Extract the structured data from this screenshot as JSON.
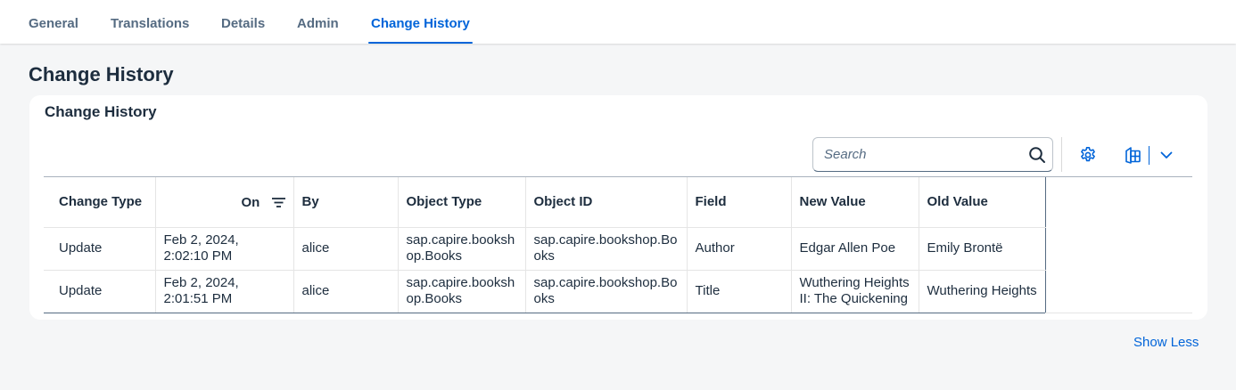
{
  "tabs": [
    {
      "label": "General"
    },
    {
      "label": "Translations"
    },
    {
      "label": "Details"
    },
    {
      "label": "Admin"
    },
    {
      "label": "Change History",
      "active": true
    }
  ],
  "section_title": "Change History",
  "card": {
    "title": "Change History",
    "search": {
      "placeholder": "Search",
      "value": ""
    },
    "toolbar": {
      "settings_icon": "gear-icon",
      "export_icon": "export-spreadsheet-icon",
      "export_menu_icon": "chevron-down-icon"
    },
    "table": {
      "columns": [
        "Change Type",
        "On",
        "By",
        "Object Type",
        "Object ID",
        "Field",
        "New Value",
        "Old Value"
      ],
      "rows": [
        {
          "change_type": "Update",
          "on_line1": "Feb 2, 2024,",
          "on_line2": "2:02:10 PM",
          "by": "alice",
          "object_type_line1": "sap.capire.booksh",
          "object_type_line2": "op.Books",
          "object_id_line1": "sap.capire.bookshop.Bo",
          "object_id_line2": "oks",
          "field": "Author",
          "new_value_line1": "Edgar Allen Poe",
          "new_value_line2": "",
          "old_value": "Emily Brontë"
        },
        {
          "change_type": "Update",
          "on_line1": "Feb 2, 2024,",
          "on_line2": "2:01:51 PM",
          "by": "alice",
          "object_type_line1": "sap.capire.booksh",
          "object_type_line2": "op.Books",
          "object_id_line1": "sap.capire.bookshop.Bo",
          "object_id_line2": "oks",
          "field": "Title",
          "new_value_line1": "Wuthering Heights",
          "new_value_line2": "II: The Quickening",
          "old_value": "Wuthering Heights"
        }
      ]
    }
  },
  "show_less_label": "Show Less",
  "colors": {
    "accent": "#0064d9",
    "text": "#1d2d3e",
    "muted": "#556b82",
    "background": "#f5f6f7"
  }
}
